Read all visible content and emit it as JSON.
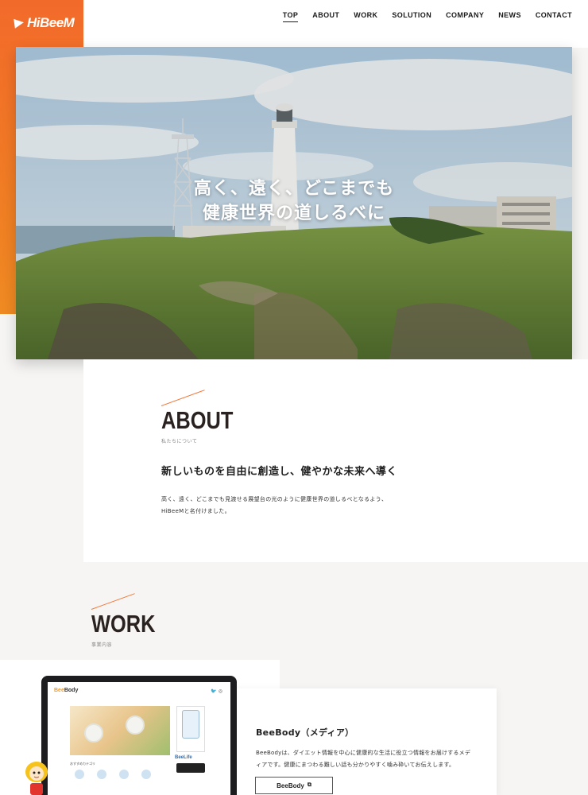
{
  "brand": {
    "logo_text": "HiBeeM",
    "accent": "#f26a2a"
  },
  "nav": {
    "items": [
      {
        "label": "TOP",
        "active": true
      },
      {
        "label": "ABOUT",
        "active": false
      },
      {
        "label": "WORK",
        "active": false
      },
      {
        "label": "SOLUTION",
        "active": false
      },
      {
        "label": "COMPANY",
        "active": false
      },
      {
        "label": "NEWS",
        "active": false
      },
      {
        "label": "CONTACT",
        "active": false
      }
    ]
  },
  "hero": {
    "line1": "高く、遠く、どこまでも",
    "line2": "健康世界の道しるべに"
  },
  "about": {
    "title": "ABOUT",
    "subtitle": "私たちについて",
    "heading": "新しいものを自由に創造し、健やかな未来へ導く",
    "body_line1": "高く、遠く、どこまでも見渡せる展望台の光のように健康世界の道しるべとなるよう、",
    "body_line2": "HiBeeMと名付けました。"
  },
  "work": {
    "title": "WORK",
    "subtitle": "事業内容",
    "card": {
      "title": "BeeBody（メディア）",
      "body_line1": "BeeBodyは、ダイエット情報を中心に健康的な生活に役立つ情報をお届けするメデ",
      "body_line2": "ィアです。健康にまつわる難しい話も分かりやすく噛み砕いてお伝えします。",
      "button_label": "BeeBody",
      "button_icon": "external-link-icon"
    },
    "screen": {
      "logo_a": "Bee",
      "logo_b": "Body",
      "app_label": "BeeLife",
      "category_label": "おすすめカテゴリ"
    }
  }
}
